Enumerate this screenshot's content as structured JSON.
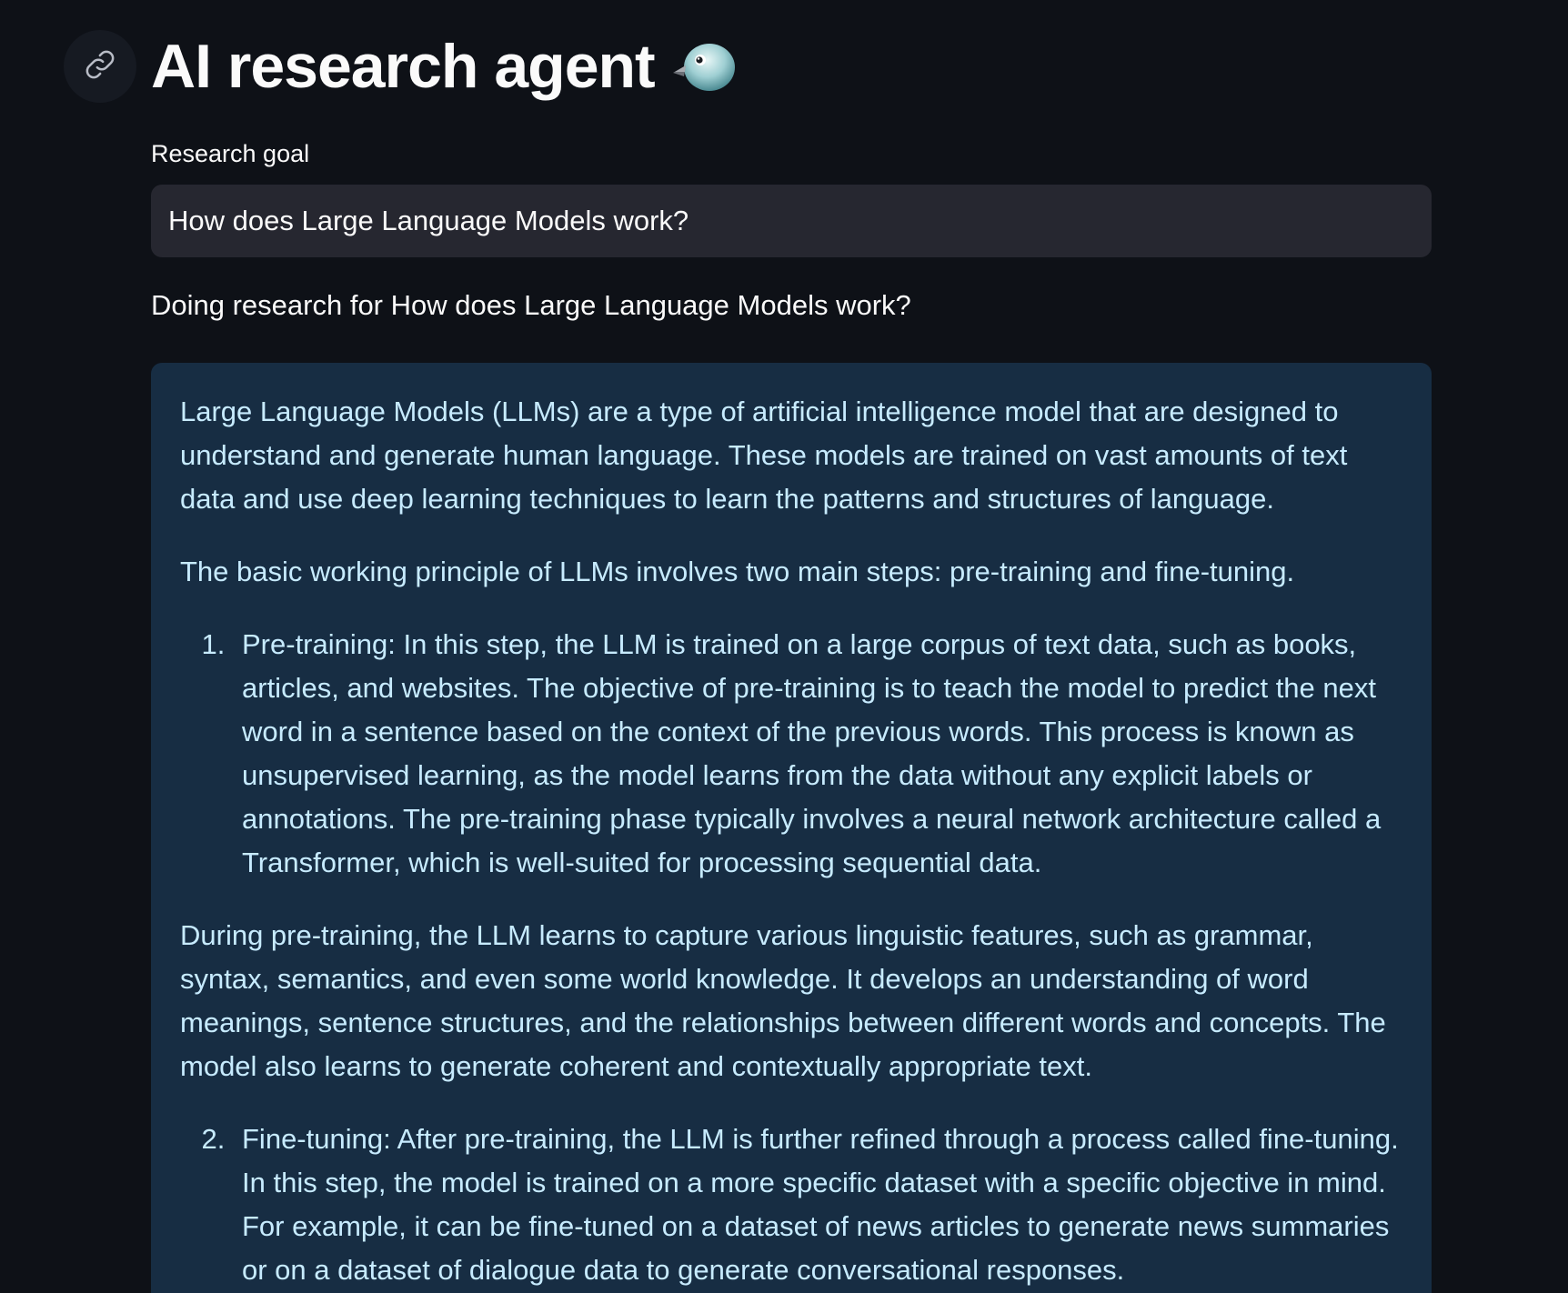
{
  "header": {
    "title": "AI research agent",
    "title_icon": "bird-icon",
    "anchor_icon": "link-icon"
  },
  "form": {
    "goal_label": "Research goal",
    "goal_value": "How does Large Language Models work?"
  },
  "status": {
    "text": "Doing research for How does Large Language Models work?"
  },
  "result": {
    "intro": "Large Language Models (LLMs) are a type of artificial intelligence model that are designed to understand and generate human language. These models are trained on vast amounts of text data and use deep learning techniques to learn the patterns and structures of language.",
    "principle": "The basic working principle of LLMs involves two main steps: pre-training and fine-tuning.",
    "step1": "Pre-training: In this step, the LLM is trained on a large corpus of text data, such as books, articles, and websites. The objective of pre-training is to teach the model to predict the next word in a sentence based on the context of the previous words. This process is known as unsupervised learning, as the model learns from the data without any explicit labels or annotations. The pre-training phase typically involves a neural network architecture called a Transformer, which is well-suited for processing sequential data.",
    "during": "During pre-training, the LLM learns to capture various linguistic features, such as grammar, syntax, semantics, and even some world knowledge. It develops an understanding of word meanings, sentence structures, and the relationships between different words and concepts. The model also learns to generate coherent and contextually appropriate text.",
    "step2": "Fine-tuning: After pre-training, the LLM is further refined through a process called fine-tuning. In this step, the model is trained on a more specific dataset with a specific objective in mind. For example, it can be fine-tuned on a dataset of news articles to generate news summaries or on a dataset of dialogue data to generate conversational responses."
  },
  "colors": {
    "background": "#0e1117",
    "input_bg": "#262730",
    "result_bg": "#172d43",
    "result_text": "#c7ebff"
  }
}
